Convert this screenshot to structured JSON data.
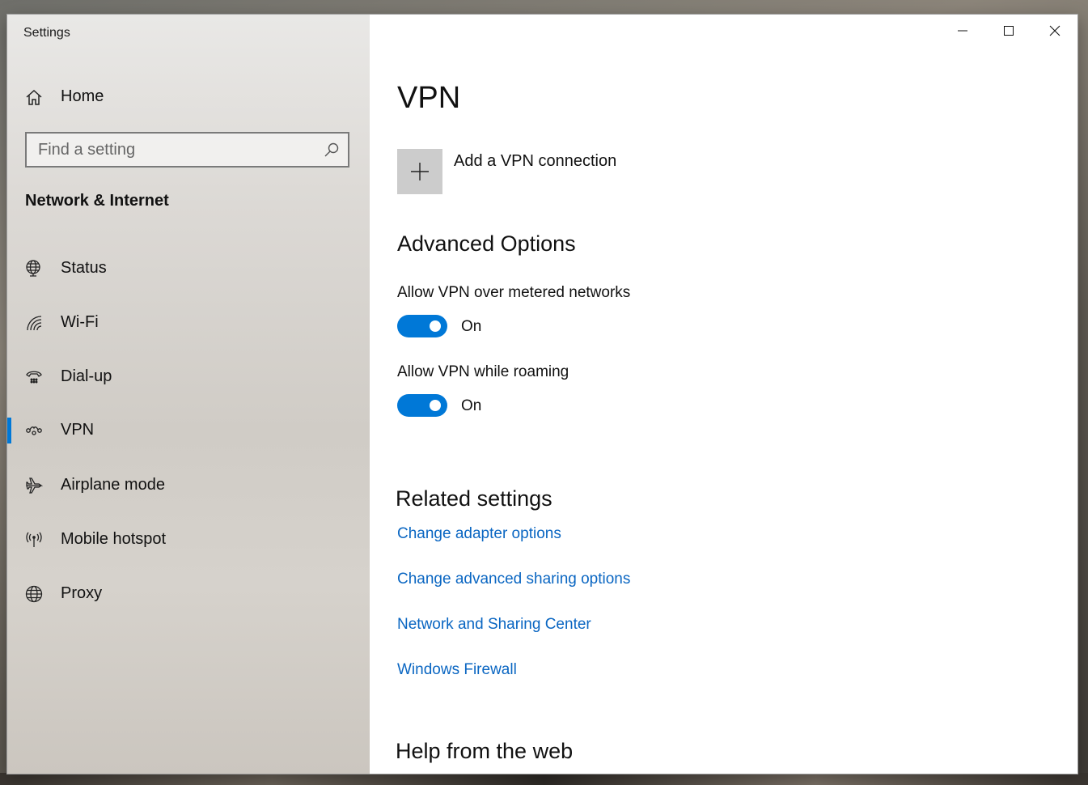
{
  "window": {
    "title": "Settings",
    "controls": {
      "minimize": "minimize-icon",
      "maximize": "maximize-icon",
      "close": "close-icon"
    }
  },
  "sidebar": {
    "home_label": "Home",
    "search": {
      "placeholder": "Find a setting",
      "value": ""
    },
    "section_title": "Network & Internet",
    "items": [
      {
        "label": "Status",
        "icon": "globe-status-icon",
        "active": false
      },
      {
        "label": "Wi-Fi",
        "icon": "wifi-icon",
        "active": false
      },
      {
        "label": "Dial-up",
        "icon": "dialup-icon",
        "active": false
      },
      {
        "label": "VPN",
        "icon": "vpn-icon",
        "active": true
      },
      {
        "label": "Airplane mode",
        "icon": "airplane-icon",
        "active": false
      },
      {
        "label": "Mobile hotspot",
        "icon": "hotspot-icon",
        "active": false
      },
      {
        "label": "Proxy",
        "icon": "globe-icon",
        "active": false
      }
    ]
  },
  "main": {
    "title": "VPN",
    "add_vpn_label": "Add a VPN connection",
    "advanced": {
      "heading": "Advanced Options",
      "options": [
        {
          "label": "Allow VPN over metered networks",
          "state": "On",
          "enabled": true
        },
        {
          "label": "Allow VPN while roaming",
          "state": "On",
          "enabled": true
        }
      ]
    },
    "related": {
      "heading": "Related settings",
      "links": [
        "Change adapter options",
        "Change advanced sharing options",
        "Network and Sharing Center",
        "Windows Firewall"
      ]
    },
    "help_heading": "Help from the web"
  },
  "colors": {
    "accent": "#0078d7",
    "link": "#0a66c2"
  }
}
